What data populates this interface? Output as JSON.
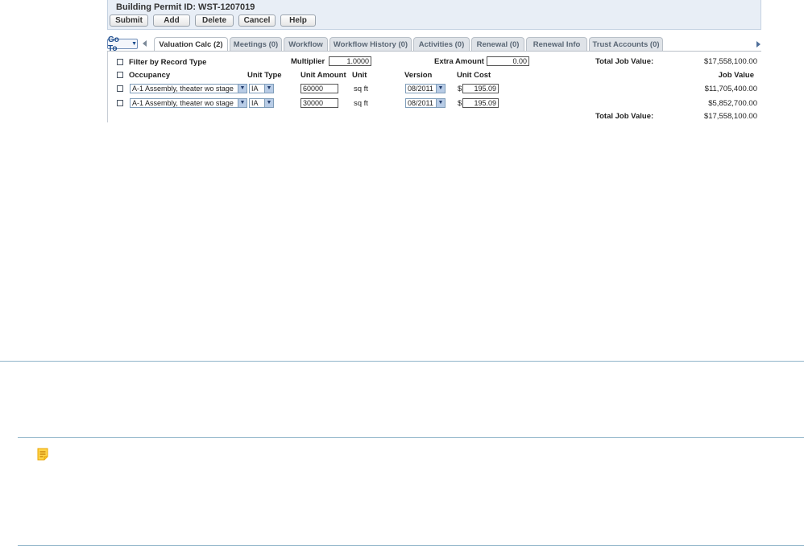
{
  "header": {
    "title": "Building Permit ID: WST-1207019",
    "buttons": {
      "submit": "Submit",
      "add": "Add",
      "delete": "Delete",
      "cancel": "Cancel",
      "help": "Help"
    }
  },
  "tabstrip": {
    "goto_label": "Go To",
    "tabs": [
      {
        "label": "Valuation Calc (2)",
        "active": true
      },
      {
        "label": "Meetings (0)",
        "active": false
      },
      {
        "label": "Workflow",
        "active": false
      },
      {
        "label": "Workflow History (0)",
        "active": false
      },
      {
        "label": "Activities (0)",
        "active": false
      },
      {
        "label": "Renewal (0)",
        "active": false
      },
      {
        "label": "Renewal Info",
        "active": false
      },
      {
        "label": "Trust Accounts (0)",
        "active": false
      }
    ]
  },
  "valuation": {
    "filter_label": "Filter by Record Type",
    "multiplier_label": "Multiplier",
    "multiplier_value": "1.0000",
    "extra_amount_label": "Extra Amount",
    "extra_amount_value": "0.00",
    "total_job_value_label": "Total Job Value:",
    "total_job_value": "$17,558,100.00",
    "columns": {
      "occupancy": "Occupancy",
      "unit_type": "Unit Type",
      "unit_amount": "Unit Amount",
      "unit": "Unit",
      "version": "Version",
      "unit_cost": "Unit Cost",
      "job_value": "Job Value"
    },
    "rows": [
      {
        "occupancy": "A-1 Assembly, theater wo stage",
        "unit_type": "IA",
        "unit_amount": "60000",
        "unit": "sq ft",
        "version": "08/2011",
        "currency": "$",
        "unit_cost": "195.09",
        "job_value": "$11,705,400.00"
      },
      {
        "occupancy": "A-1 Assembly, theater wo stage",
        "unit_type": "IA",
        "unit_amount": "30000",
        "unit": "sq ft",
        "version": "08/2011",
        "currency": "$",
        "unit_cost": "195.09",
        "job_value": "$5,852,700.00"
      }
    ],
    "footer_total_label": "Total Job Value:",
    "footer_total_value": "$17,558,100.00"
  },
  "colors": {
    "header_bg": "#e8eef6",
    "divider": "#8fb4c9",
    "note_icon": "#e8a400"
  },
  "icons": [
    "go-to-caret-icon",
    "tab-scroll-left-icon",
    "tab-scroll-right-icon",
    "dropdown-arrow-icon",
    "note-icon"
  ]
}
